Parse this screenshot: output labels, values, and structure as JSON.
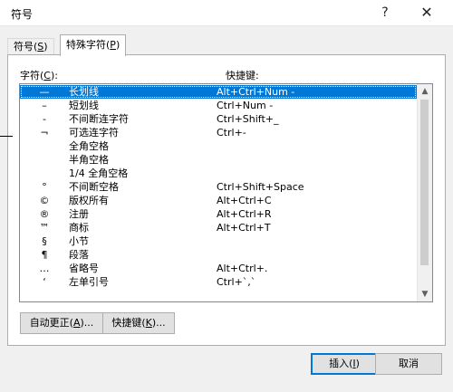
{
  "window": {
    "title": "符号",
    "help_glyph": "?",
    "close_glyph": "✕"
  },
  "tabs": [
    {
      "label": "符号(",
      "key": "S",
      "suffix": ")",
      "selected": false
    },
    {
      "label": "特殊字符(",
      "key": "P",
      "suffix": ")",
      "selected": true
    }
  ],
  "columns": {
    "char": "字符(",
    "char_key": "C",
    "char_suffix": "):",
    "shortcut": "快捷键:"
  },
  "rows": [
    {
      "symbol": "—",
      "name": "长划线",
      "shortcut": "Alt+Ctrl+Num -",
      "selected": true
    },
    {
      "symbol": "–",
      "name": "短划线",
      "shortcut": "Ctrl+Num -"
    },
    {
      "symbol": "-",
      "name": "不间断连字符",
      "shortcut": "Ctrl+Shift+_"
    },
    {
      "symbol": "¬",
      "name": "可选连字符",
      "shortcut": "Ctrl+-"
    },
    {
      "symbol": "",
      "name": "全角空格",
      "shortcut": ""
    },
    {
      "symbol": "",
      "name": "半角空格",
      "shortcut": ""
    },
    {
      "symbol": "",
      "name": "1/4 全角空格",
      "shortcut": ""
    },
    {
      "symbol": "°",
      "name": "不间断空格",
      "shortcut": "Ctrl+Shift+Space"
    },
    {
      "symbol": "©",
      "name": "版权所有",
      "shortcut": "Alt+Ctrl+C"
    },
    {
      "symbol": "®",
      "name": "注册",
      "shortcut": "Alt+Ctrl+R"
    },
    {
      "symbol": "™",
      "name": "商标",
      "shortcut": "Alt+Ctrl+T"
    },
    {
      "symbol": "§",
      "name": "小节",
      "shortcut": ""
    },
    {
      "symbol": "¶",
      "name": "段落",
      "shortcut": ""
    },
    {
      "symbol": "…",
      "name": "省略号",
      "shortcut": "Alt+Ctrl+."
    },
    {
      "symbol": "‘",
      "name": "左单引号",
      "shortcut": "Ctrl+`,`"
    }
  ],
  "buttons": {
    "autocorrect": {
      "label": "自动更正(",
      "key": "A",
      "suffix": ")..."
    },
    "shortcut": {
      "label": "快捷键(",
      "key": "K",
      "suffix": ")..."
    },
    "insert": {
      "label": "插入(",
      "key": "I",
      "suffix": ")"
    },
    "cancel": {
      "label": "取消"
    }
  },
  "scrollbar": {
    "up": "▲",
    "down": "▼"
  },
  "colors": {
    "selection": "#0078d7",
    "dialog_bg": "#f0f0f0"
  }
}
